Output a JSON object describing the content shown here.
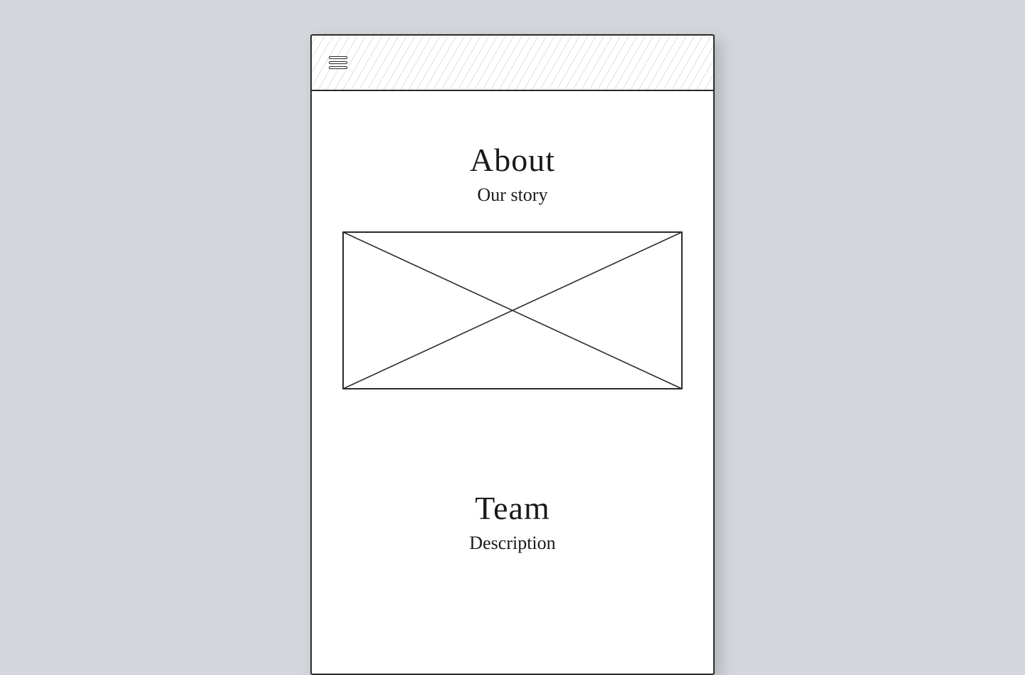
{
  "navbar": {
    "menu_icon": "hamburger-icon"
  },
  "sections": {
    "about": {
      "heading": "About",
      "subheading": "Our story"
    },
    "team": {
      "heading": "Team",
      "subheading": "Description"
    }
  }
}
